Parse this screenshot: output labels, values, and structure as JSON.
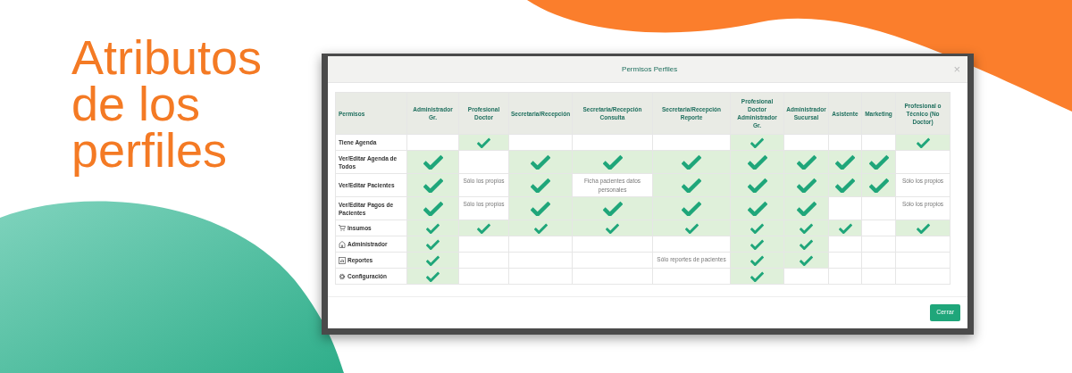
{
  "heading": "Atributos de los perfiles",
  "modal": {
    "title": "Permisos Perfiles",
    "close": "×",
    "button": "Cerrar"
  },
  "table": {
    "columns": [
      "Permisos",
      "Administrador Gr.",
      "Profesional Doctor",
      "Secretaria/Recepción",
      "Secretaria/Recepción Consulta",
      "Secretaria/Recepción Reporte",
      "Profesional Doctor Administrador Gr.",
      "Administrador Sucursal",
      "Asistente",
      "Marketing",
      "Profesional o Técnico (No Doctor)"
    ],
    "rows": [
      {
        "cells": [
          {
            "kind": "label",
            "text": "Tiene Agenda"
          },
          {
            "kind": "empty"
          },
          {
            "kind": "check"
          },
          {
            "kind": "empty"
          },
          {
            "kind": "empty"
          },
          {
            "kind": "empty"
          },
          {
            "kind": "check"
          },
          {
            "kind": "empty"
          },
          {
            "kind": "empty"
          },
          {
            "kind": "empty"
          },
          {
            "kind": "check"
          }
        ]
      },
      {
        "cells": [
          {
            "kind": "label",
            "text": "Ver/Editar Agenda de Todos"
          },
          {
            "kind": "check"
          },
          {
            "kind": "empty"
          },
          {
            "kind": "check"
          },
          {
            "kind": "check"
          },
          {
            "kind": "check"
          },
          {
            "kind": "check"
          },
          {
            "kind": "check"
          },
          {
            "kind": "check"
          },
          {
            "kind": "check"
          },
          {
            "kind": "empty"
          }
        ]
      },
      {
        "cells": [
          {
            "kind": "label",
            "text": "Ver/Editar Pacientes"
          },
          {
            "kind": "check"
          },
          {
            "kind": "text",
            "text": "Sólo los propios"
          },
          {
            "kind": "check"
          },
          {
            "kind": "text",
            "text": "Ficha pacientes datos personales"
          },
          {
            "kind": "check"
          },
          {
            "kind": "check"
          },
          {
            "kind": "check"
          },
          {
            "kind": "check"
          },
          {
            "kind": "check"
          },
          {
            "kind": "text",
            "text": "Sólo los propios"
          }
        ]
      },
      {
        "cells": [
          {
            "kind": "label",
            "text": "Ver/Editar Pagos de Pacientes"
          },
          {
            "kind": "check"
          },
          {
            "kind": "text",
            "text": "Sólo los propios"
          },
          {
            "kind": "check"
          },
          {
            "kind": "check"
          },
          {
            "kind": "check"
          },
          {
            "kind": "check"
          },
          {
            "kind": "check"
          },
          {
            "kind": "empty"
          },
          {
            "kind": "empty"
          },
          {
            "kind": "text",
            "text": "Sólo los propios"
          }
        ]
      },
      {
        "cells": [
          {
            "kind": "label",
            "text": "Insumos"
          },
          {
            "kind": "check"
          },
          {
            "kind": "check"
          },
          {
            "kind": "check"
          },
          {
            "kind": "check"
          },
          {
            "kind": "check"
          },
          {
            "kind": "check"
          },
          {
            "kind": "check"
          },
          {
            "kind": "check"
          },
          {
            "kind": "empty"
          },
          {
            "kind": "check"
          }
        ]
      },
      {
        "cells": [
          {
            "kind": "label",
            "text": "Administrador"
          },
          {
            "kind": "check"
          },
          {
            "kind": "empty"
          },
          {
            "kind": "empty"
          },
          {
            "kind": "empty"
          },
          {
            "kind": "empty"
          },
          {
            "kind": "check"
          },
          {
            "kind": "check"
          },
          {
            "kind": "empty"
          },
          {
            "kind": "empty"
          },
          {
            "kind": "empty"
          }
        ]
      },
      {
        "cells": [
          {
            "kind": "label",
            "text": "Reportes"
          },
          {
            "kind": "check"
          },
          {
            "kind": "empty"
          },
          {
            "kind": "empty"
          },
          {
            "kind": "empty"
          },
          {
            "kind": "text",
            "text": "Sólo reportes de pacientes"
          },
          {
            "kind": "check"
          },
          {
            "kind": "check"
          },
          {
            "kind": "empty"
          },
          {
            "kind": "empty"
          },
          {
            "kind": "empty"
          }
        ]
      },
      {
        "cells": [
          {
            "kind": "label",
            "text": "Configuración"
          },
          {
            "kind": "check"
          },
          {
            "kind": "empty"
          },
          {
            "kind": "empty"
          },
          {
            "kind": "empty"
          },
          {
            "kind": "empty"
          },
          {
            "kind": "check"
          },
          {
            "kind": "empty"
          },
          {
            "kind": "empty"
          },
          {
            "kind": "empty"
          },
          {
            "kind": "empty"
          }
        ]
      }
    ]
  }
}
